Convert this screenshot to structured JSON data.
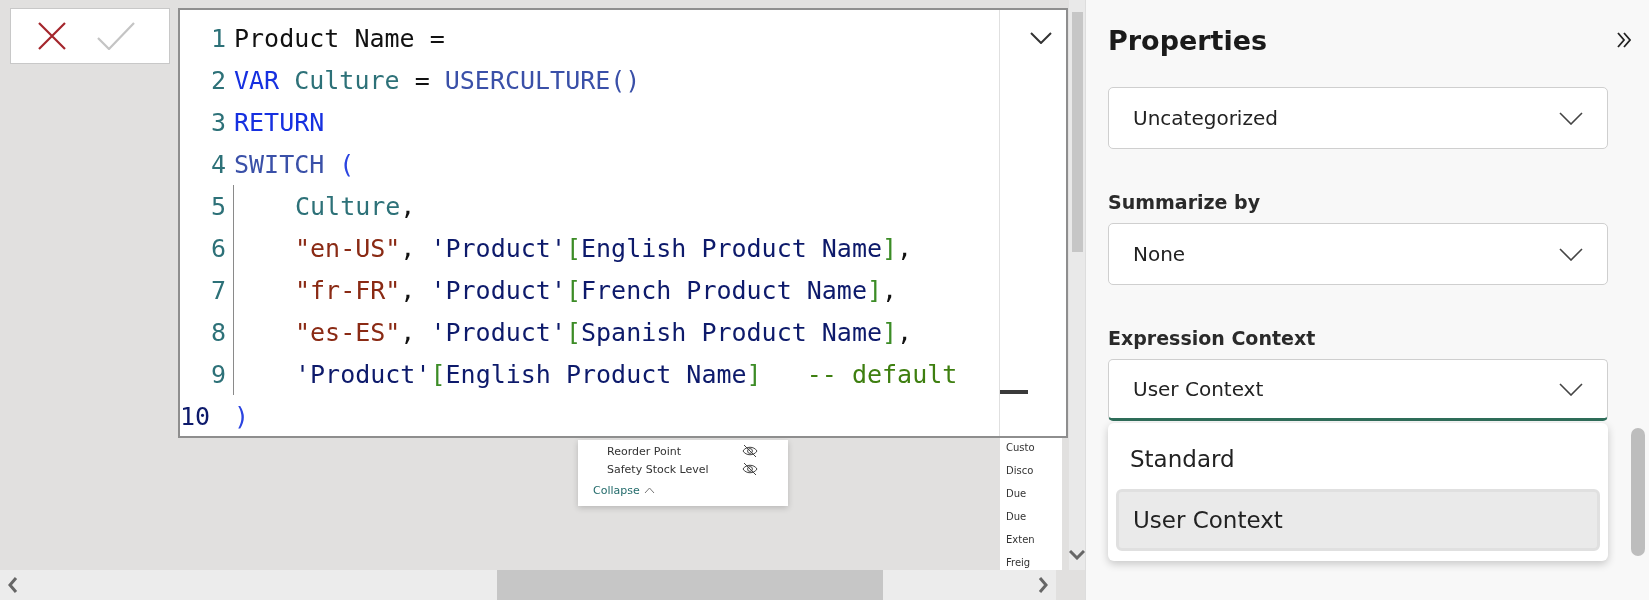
{
  "editor": {
    "lines": [
      {
        "number": "1",
        "active": false,
        "indented": false,
        "tokens": [
          {
            "kind": "plain",
            "text": "Product Name ="
          }
        ]
      },
      {
        "number": "2",
        "active": false,
        "indented": false,
        "tokens": [
          {
            "kind": "keyword",
            "text": "VAR"
          },
          {
            "kind": "variable",
            "text": " Culture"
          },
          {
            "kind": "plain",
            "text": " = "
          },
          {
            "kind": "function",
            "text": "USERCULTURE()"
          }
        ]
      },
      {
        "number": "3",
        "active": false,
        "indented": false,
        "tokens": [
          {
            "kind": "keyword",
            "text": "RETURN"
          }
        ]
      },
      {
        "number": "4",
        "active": false,
        "indented": false,
        "tokens": [
          {
            "kind": "function",
            "text": "SWITCH"
          },
          {
            "kind": "paren",
            "text": " ("
          }
        ]
      },
      {
        "number": "5",
        "active": false,
        "indented": true,
        "tokens": [
          {
            "kind": "variable",
            "text": "Culture"
          },
          {
            "kind": "plain",
            "text": ","
          }
        ]
      },
      {
        "number": "6",
        "active": false,
        "indented": true,
        "tokens": [
          {
            "kind": "string",
            "text": "\"en-US\""
          },
          {
            "kind": "plain",
            "text": ", "
          },
          {
            "kind": "table",
            "text": "'Product'"
          },
          {
            "kind": "bracket",
            "text": "["
          },
          {
            "kind": "table",
            "text": "English Product Name"
          },
          {
            "kind": "bracket",
            "text": "]"
          },
          {
            "kind": "plain",
            "text": ","
          }
        ]
      },
      {
        "number": "7",
        "active": false,
        "indented": true,
        "tokens": [
          {
            "kind": "string",
            "text": "\"fr-FR\""
          },
          {
            "kind": "plain",
            "text": ", "
          },
          {
            "kind": "table",
            "text": "'Product'"
          },
          {
            "kind": "bracket",
            "text": "["
          },
          {
            "kind": "table",
            "text": "French Product Name"
          },
          {
            "kind": "bracket",
            "text": "]"
          },
          {
            "kind": "plain",
            "text": ","
          }
        ]
      },
      {
        "number": "8",
        "active": false,
        "indented": true,
        "tokens": [
          {
            "kind": "string",
            "text": "\"es-ES\""
          },
          {
            "kind": "plain",
            "text": ", "
          },
          {
            "kind": "table",
            "text": "'Product'"
          },
          {
            "kind": "bracket",
            "text": "["
          },
          {
            "kind": "table",
            "text": "Spanish Product Name"
          },
          {
            "kind": "bracket",
            "text": "]"
          },
          {
            "kind": "plain",
            "text": ","
          }
        ]
      },
      {
        "number": "9",
        "active": false,
        "indented": true,
        "tokens": [
          {
            "kind": "table",
            "text": "'Product'"
          },
          {
            "kind": "bracket",
            "text": "["
          },
          {
            "kind": "table",
            "text": "English Product Name"
          },
          {
            "kind": "bracket",
            "text": "]"
          },
          {
            "kind": "comment",
            "text": "   -- default"
          }
        ]
      },
      {
        "number": "10",
        "active": true,
        "indented": false,
        "tokens": [
          {
            "kind": "paren",
            "text": ")"
          }
        ]
      }
    ]
  },
  "field_popup": {
    "items": [
      {
        "label": "Reorder Point",
        "hidden": true
      },
      {
        "label": "Safety Stock Level",
        "hidden": true
      }
    ],
    "collapse": "Collapse"
  },
  "field_list": {
    "items": [
      "Custo",
      "Disco",
      "Due",
      "Due",
      "Exten",
      "Freig"
    ]
  },
  "properties": {
    "title": "Properties",
    "fields": [
      {
        "value": "Uncategorized",
        "expanded": false
      },
      {
        "label": "Summarize by",
        "value": "None",
        "expanded": false
      },
      {
        "label": "Expression Context",
        "value": "User Context",
        "expanded": true,
        "options": [
          {
            "label": "Standard",
            "selected": false
          },
          {
            "label": "User Context",
            "selected": true
          }
        ]
      }
    ]
  }
}
